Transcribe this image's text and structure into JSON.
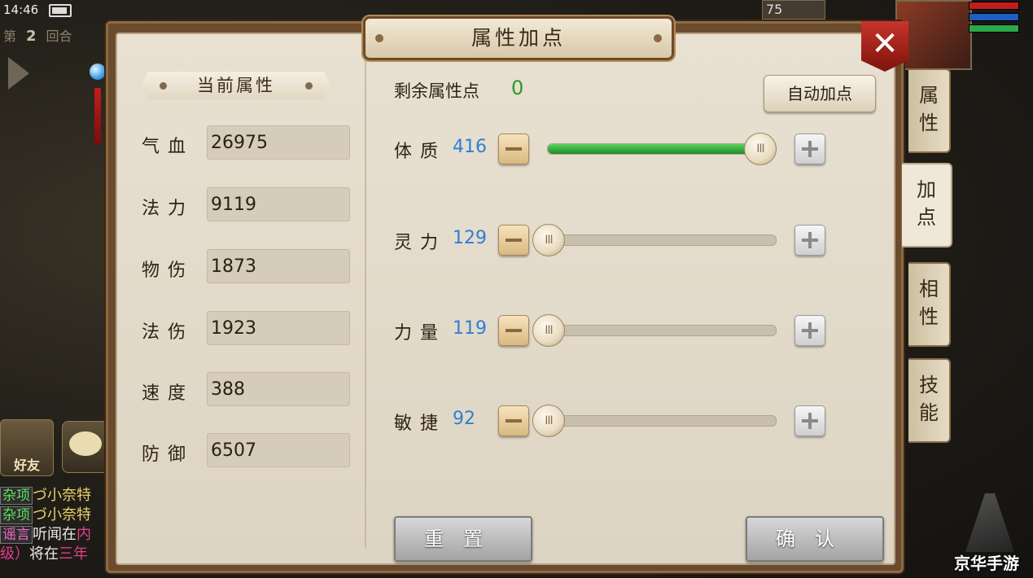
{
  "status": {
    "time": "14:46"
  },
  "battle": {
    "round_prefix": "第",
    "round_number": "2",
    "round_suffix": "回合",
    "ally_hp_value": "75"
  },
  "dock": {
    "friends_label": "好友"
  },
  "chat": [
    {
      "tag": "杂项",
      "text": "づ小奈特"
    },
    {
      "tag": "杂项",
      "text": "づ小奈特"
    },
    {
      "tag": "谣言",
      "text": "听闻在",
      "highlight": "内"
    },
    {
      "tag": "",
      "text": "将在",
      "prefix": "级）",
      "highlight": "三年"
    }
  ],
  "panel": {
    "title": "属性加点",
    "close_label": "✕",
    "current": {
      "header": "当前属性",
      "stats": [
        {
          "name": "气血",
          "value": "26975"
        },
        {
          "name": "法力",
          "value": "9119"
        },
        {
          "name": "物伤",
          "value": "1873"
        },
        {
          "name": "法伤",
          "value": "1923"
        },
        {
          "name": "速度",
          "value": "388"
        },
        {
          "name": "防御",
          "value": "6507"
        }
      ]
    },
    "allocate": {
      "remaining_label": "剩余属性点",
      "remaining_value": "0",
      "auto_button": "自动加点",
      "attributes": [
        {
          "name": "体质",
          "value": "416",
          "level": 0.93
        },
        {
          "name": "灵力",
          "value": "129",
          "level": 0.0
        },
        {
          "name": "力量",
          "value": "119",
          "level": 0.0
        },
        {
          "name": "敏捷",
          "value": "92",
          "level": 0.0
        }
      ],
      "thumb_glyph": "III",
      "reset_button": "重置",
      "confirm_button": "确认"
    }
  },
  "tabs": [
    {
      "label": "属\n性",
      "active": false
    },
    {
      "label": "加\n点",
      "active": true
    },
    {
      "label": "相\n性",
      "active": false
    },
    {
      "label": "技\n能",
      "active": false
    }
  ],
  "watermark": "京华手游",
  "colors": {
    "remaining": "#2a9a2a",
    "attr_value": "#2e7fd6",
    "slider_fill": "#3fb545",
    "close": "#b52a20"
  }
}
